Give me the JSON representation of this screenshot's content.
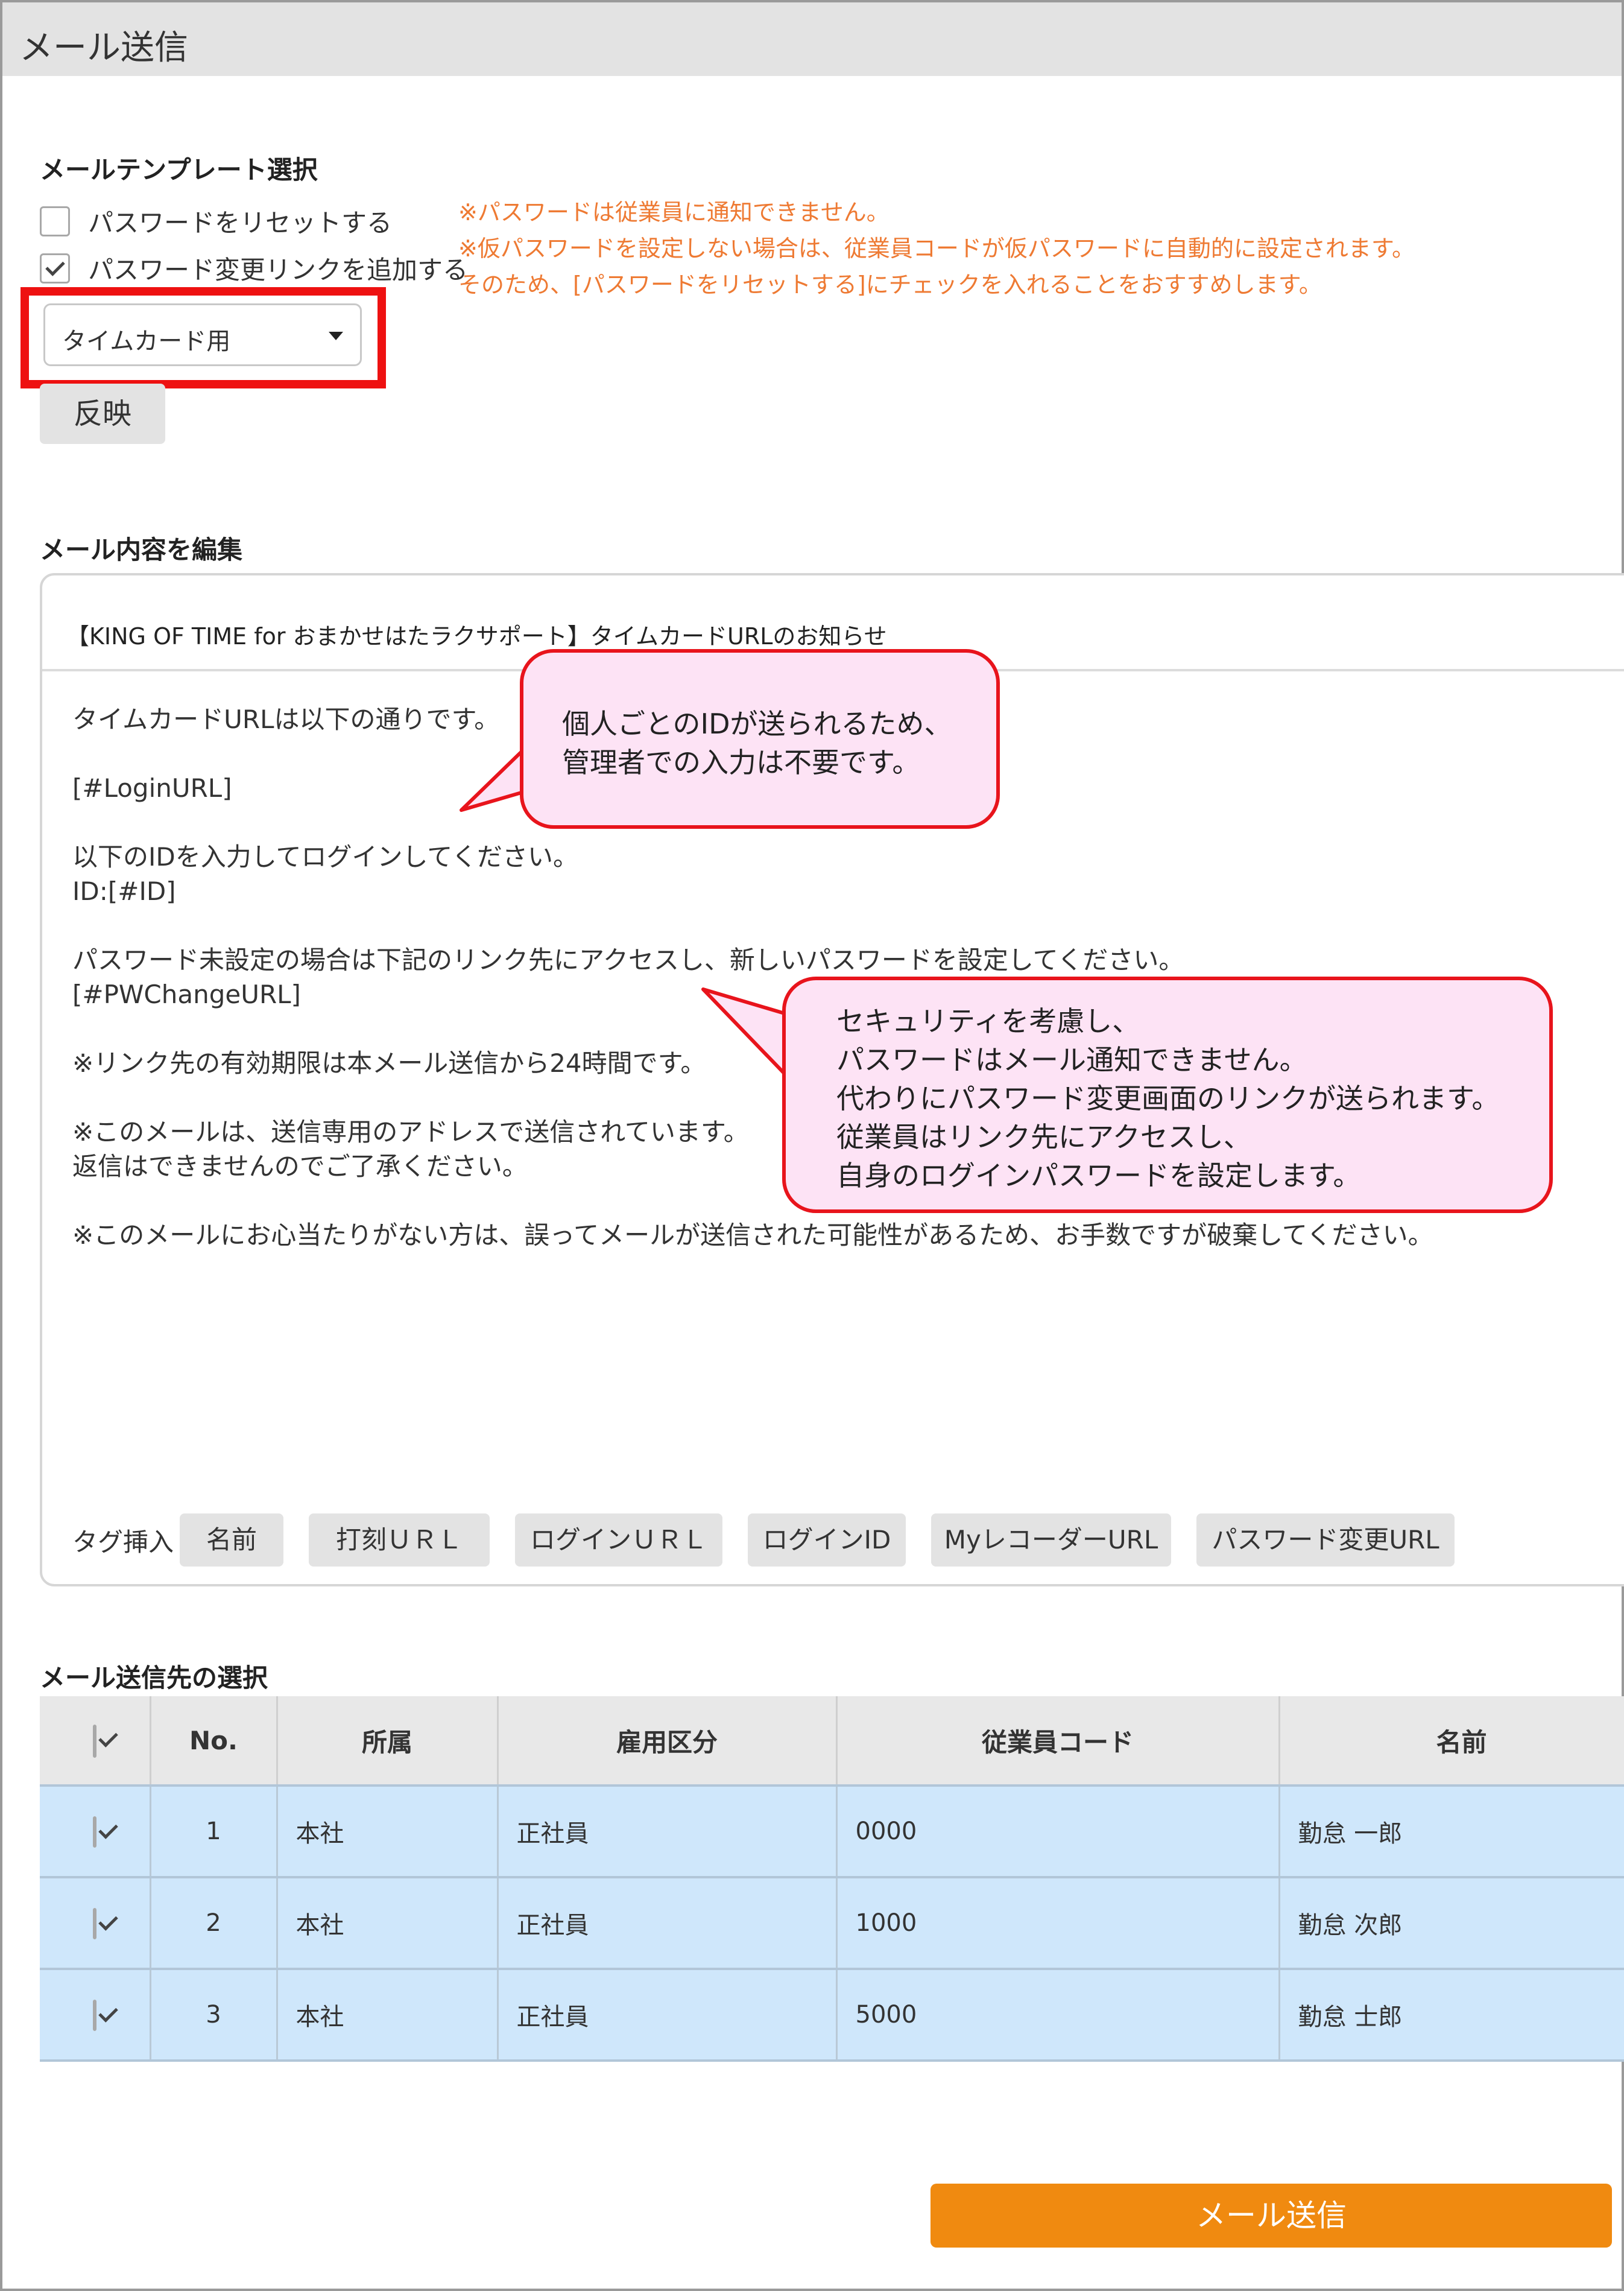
{
  "window": {
    "title": "メール送信"
  },
  "template": {
    "heading": "メールテンプレート選択",
    "reset_label": "パスワードをリセットする",
    "reset_checked": false,
    "add_link_label": "パスワード変更リンクを追加する",
    "add_link_checked": true,
    "notes": [
      "※パスワードは従業員に通知できません。",
      "※仮パスワードを設定しない場合は、従業員コードが仮パスワードに自動的に設定されます。",
      "そのため、[パスワードをリセットする]にチェックを入れることをおすすめします。"
    ],
    "select_value": "タイムカード用",
    "apply_label": "反映"
  },
  "editor": {
    "heading": "メール内容を編集",
    "subject": "【KING OF TIME for おまかせはたラクサポート】タイムカードURLのお知らせ",
    "body": "タイムカードURLは以下の通りです。\n\n[#LoginURL]\n\n以下のIDを入力してログインしてください。\nID:[#ID]\n\nパスワード未設定の場合は下記のリンク先にアクセスし、新しいパスワードを設定してください。\n[#PWChangeURL]\n\n※リンク先の有効期限は本メール送信から24時間です。\n\n※このメールは、送信専用のアドレスで送信されています。\n返信はできませんのでご了承ください。\n\n※このメールにお心当たりがない方は、誤ってメールが送信された可能性があるため、お手数ですが破棄してください。",
    "tag_label": "タグ挿入",
    "tags": [
      "名前",
      "打刻ＵＲＬ",
      "ログインＵＲＬ",
      "ログインID",
      "MyレコーダーURL",
      "パスワード変更URL"
    ]
  },
  "callouts": {
    "id_note": "個人ごとのIDが送られるため、\n管理者での入力は不要です。",
    "password_note": "セキュリティを考慮し、\nパスワードはメール通知できません。\n代わりにパスワード変更画面のリンクが送られます。\n従業員はリンク先にアクセスし、\n自身のログインパスワードを設定します。"
  },
  "recipients": {
    "heading": "メール送信先の選択",
    "columns": [
      "No.",
      "所属",
      "雇用区分",
      "従業員コード",
      "名前"
    ],
    "rows": [
      {
        "checked": true,
        "no": "1",
        "dept": "本社",
        "type": "正社員",
        "code": "0000",
        "name": "勤怠 一郎"
      },
      {
        "checked": true,
        "no": "2",
        "dept": "本社",
        "type": "正社員",
        "code": "1000",
        "name": "勤怠 次郎"
      },
      {
        "checked": true,
        "no": "3",
        "dept": "本社",
        "type": "正社員",
        "code": "5000",
        "name": "勤怠 士郎"
      }
    ]
  },
  "send_label": "メール送信",
  "colors": {
    "accent_orange": "#f08a10",
    "note_orange": "#ee7a33",
    "highlight_red": "#ee1111",
    "row_blue": "#cfe7fb",
    "bubble_pink": "#fde3f5"
  }
}
